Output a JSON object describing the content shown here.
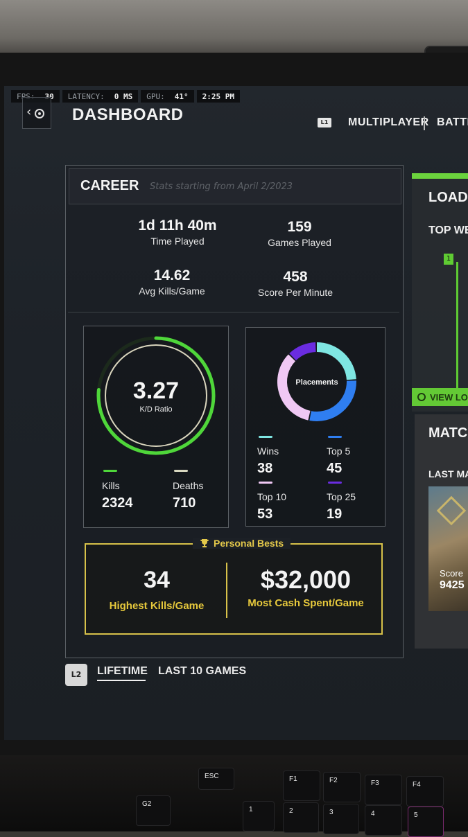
{
  "hud": {
    "fps_label": "FPS:",
    "fps_value": "30",
    "latency_label": "LATENCY:",
    "latency_value": "0 MS",
    "gpu_label": "GPU:",
    "gpu_value": "41°",
    "time": "2:25 PM"
  },
  "header": {
    "title": "DASHBOARD",
    "l1_badge": "L1",
    "tabs": [
      {
        "label": "MULTIPLAYER"
      },
      {
        "label": "BATTL"
      }
    ]
  },
  "career": {
    "title": "CAREER",
    "subtitle": "Stats starting from April 2/2023",
    "stats": [
      {
        "value": "1d 11h 40m",
        "label": "Time Played"
      },
      {
        "value": "159",
        "label": "Games Played"
      },
      {
        "value": "14.62",
        "label": "Avg Kills/Game"
      },
      {
        "value": "458",
        "label": "Score Per Minute"
      }
    ],
    "kd": {
      "value": "3.27",
      "label": "K/D Ratio",
      "kills_label": "Kills",
      "kills_value": "2324",
      "deaths_label": "Deaths",
      "deaths_value": "710",
      "kills_fraction": 0.766,
      "kills_color": "#4fd63a",
      "deaths_color": "#d8d8c0"
    },
    "placements": {
      "title": "Placements",
      "items": [
        {
          "label": "Wins",
          "value": "38",
          "color": "#7fe6e2"
        },
        {
          "label": "Top 5",
          "value": "45",
          "color": "#2f7ef0"
        },
        {
          "label": "Top 10",
          "value": "53",
          "color": "#f0c8f4"
        },
        {
          "label": "Top 25",
          "value": "19",
          "color": "#6a2ce0"
        }
      ]
    },
    "personal_bests": {
      "title": "Personal Bests",
      "icon": "trophy-icon",
      "accent": "#e3c84a",
      "items": [
        {
          "value": "34",
          "label": "Highest Kills/Game"
        },
        {
          "value": "$32,000",
          "label": "Most Cash Spent/Game"
        }
      ]
    }
  },
  "bottom_tabs": {
    "badge": "L2",
    "items": [
      {
        "label": "LIFETIME",
        "active": true
      },
      {
        "label": "LAST 10 GAMES",
        "active": false
      }
    ]
  },
  "right": {
    "loadout_title": "LOAD",
    "loadout_sub": "TOP WE",
    "loadout_tag": "1",
    "view_button": "VIEW LO",
    "match_title": "MATC",
    "last_match": "LAST MAT",
    "score_label": "Score",
    "score_value": "9425"
  },
  "keyboard": {
    "keys": [
      "G2",
      "ESC",
      "F1",
      "F2",
      "F3",
      "F4",
      "1",
      "2",
      "3",
      "4",
      "5"
    ]
  }
}
